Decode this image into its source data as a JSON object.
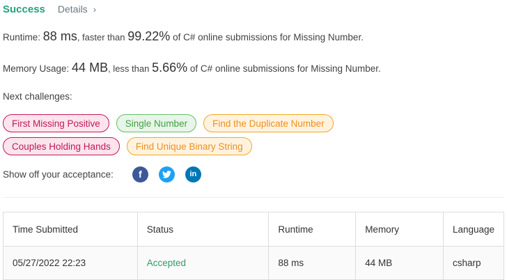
{
  "header": {
    "status": "Success",
    "details_label": "Details",
    "chevron": "›"
  },
  "runtime": {
    "label": "Runtime:",
    "value": "88 ms",
    "mid": ", faster than",
    "percent": "99.22%",
    "suffix": "of C# online submissions for Missing Number."
  },
  "memory": {
    "label": "Memory Usage:",
    "value": "44 MB",
    "mid": ", less than",
    "percent": "5.66%",
    "suffix": "of C# online submissions for Missing Number."
  },
  "next_challenges_label": "Next challenges:",
  "challenges": [
    {
      "label": "First Missing Positive",
      "difficulty": "hard"
    },
    {
      "label": "Single Number",
      "difficulty": "easy"
    },
    {
      "label": "Find the Duplicate Number",
      "difficulty": "medium"
    },
    {
      "label": "Couples Holding Hands",
      "difficulty": "hard"
    },
    {
      "label": "Find Unique Binary String",
      "difficulty": "medium"
    }
  ],
  "share": {
    "label": "Show off your acceptance:",
    "icons": [
      "facebook-icon",
      "twitter-icon",
      "linkedin-icon"
    ]
  },
  "table": {
    "headers": [
      "Time Submitted",
      "Status",
      "Runtime",
      "Memory",
      "Language"
    ],
    "rows": [
      [
        "05/27/2022 22:23",
        "Accepted",
        "88 ms",
        "44 MB",
        "csharp"
      ]
    ]
  },
  "colors": {
    "success": "#26a17c",
    "hard": "#c2185b",
    "easy": "#43a047",
    "medium": "#ef8f1a"
  }
}
